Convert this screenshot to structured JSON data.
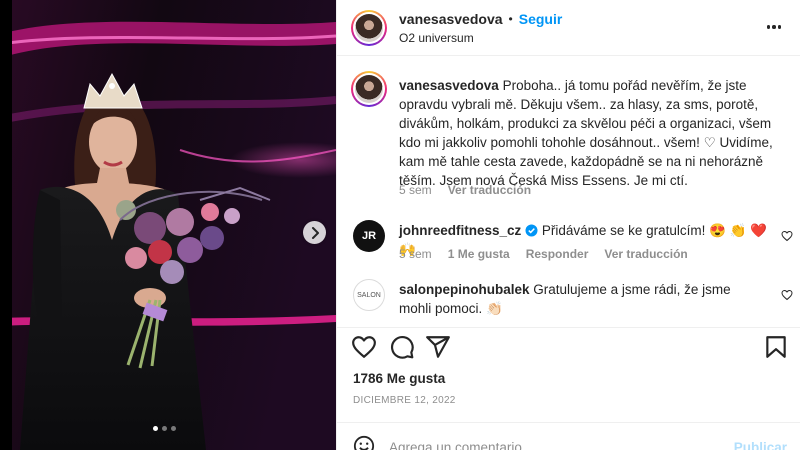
{
  "post": {
    "username": "vanesasvedova",
    "separator": "•",
    "follow_label": "Seguir",
    "location": "O2 universum",
    "caption_user": "vanesasvedova",
    "caption_text": "Proboha.. já tomu pořád nevěřím, že jste opravdu vybrali mě. Děkuju všem.. za hlasy, za sms, porotě, divákům, holkám, produkci za skvělou péči a organizaci, všem kdo mi jakkoliv pomohli tohohle dosáhnout.. všem! ♡ Uvidíme, kam mě tahle cesta zavede, každopádně se na ni nehorázně těším. Jsem nová Česká Miss Essens. Je mi ctí.",
    "caption_time": "5 sem",
    "translate_label": "Ver traducción",
    "likes": "1786 Me gusta",
    "date": "DICIEMBRE 12, 2022"
  },
  "comments": [
    {
      "user": "johnreedfitness_cz",
      "verified": true,
      "text": "Přidáváme se ke gratulcím! 😍 👏 ❤️ 🙌",
      "time": "5 sem",
      "likes": "1 Me gusta",
      "reply": "Responder",
      "translate": "Ver traducción",
      "avatar_text": "JR"
    },
    {
      "user": "salonpepinohubalek",
      "text": "Gratulujeme a jsme rádi, že jsme mohli pomoci. 👏🏻",
      "avatar_text": "SALON"
    }
  ],
  "composer": {
    "placeholder": "Agrega un comentario...",
    "publish_label": "Publicar"
  },
  "icons": {
    "next": "chevron-right-icon",
    "more": "more-options-icon",
    "like": "heart-icon",
    "comment": "comment-icon",
    "share": "paper-plane-icon",
    "save": "bookmark-icon",
    "emoji": "emoji-icon"
  },
  "colors": {
    "follow": "#0095f6",
    "muted": "#8e8e8e",
    "stage_pink": "#e0208c"
  }
}
